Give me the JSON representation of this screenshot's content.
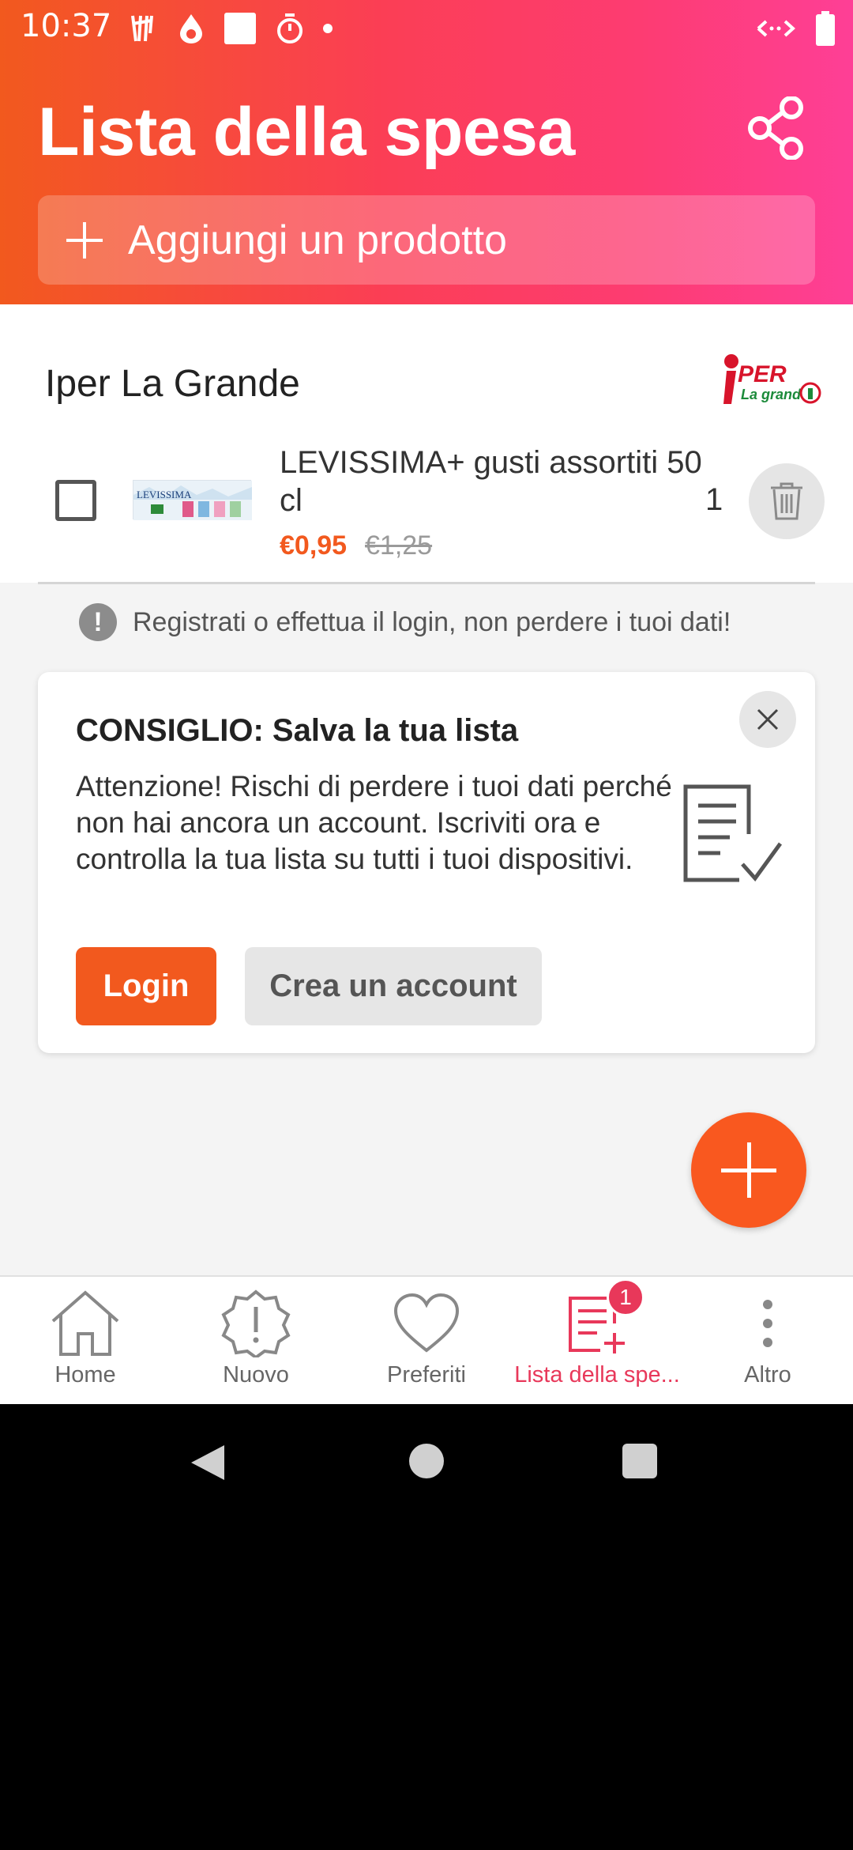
{
  "status_bar": {
    "time": "10:37",
    "icons": [
      "harry-potter-icon",
      "water-drop-icon",
      "square-icon",
      "timer-icon",
      "dot-icon",
      "data-arrows-icon",
      "battery-icon"
    ]
  },
  "header": {
    "title": "Lista della spesa",
    "share_icon": "share-icon",
    "add_product_label": "Aggiungi un prodotto"
  },
  "store": {
    "name": "Iper La Grande",
    "logo_text": "PER",
    "logo_subtext": "La grande"
  },
  "items": [
    {
      "name": "LEVISSIMA+ gusti assortiti 50 cl",
      "price": "€0,95",
      "old_price": "€1,25",
      "quantity": "1",
      "image_text": "LEVISSIMA"
    }
  ],
  "login_hint": "Registrati o effettua il login, non perdere i tuoi dati!",
  "tip": {
    "title": "CONSIGLIO: Salva la tua lista",
    "body": "Attenzione! Rischi di perdere i tuoi dati perché non hai ancora un account. Iscriviti ora e controlla la tua lista su tutti i tuoi dispositivi.",
    "login_label": "Login",
    "create_account_label": "Crea un account"
  },
  "bottom_nav": {
    "items": [
      {
        "label": "Home",
        "icon": "home-icon"
      },
      {
        "label": "Nuovo",
        "icon": "new-badge-icon"
      },
      {
        "label": "Preferiti",
        "icon": "heart-icon"
      },
      {
        "label": "Lista della spe...",
        "icon": "list-add-icon",
        "badge": "1",
        "active": true
      },
      {
        "label": "Altro",
        "icon": "more-vertical-icon"
      }
    ]
  },
  "colors": {
    "accent": "#f2591e",
    "active_nav": "#e8385a",
    "header_gradient": [
      "#f2591e",
      "#fe3f96"
    ]
  }
}
